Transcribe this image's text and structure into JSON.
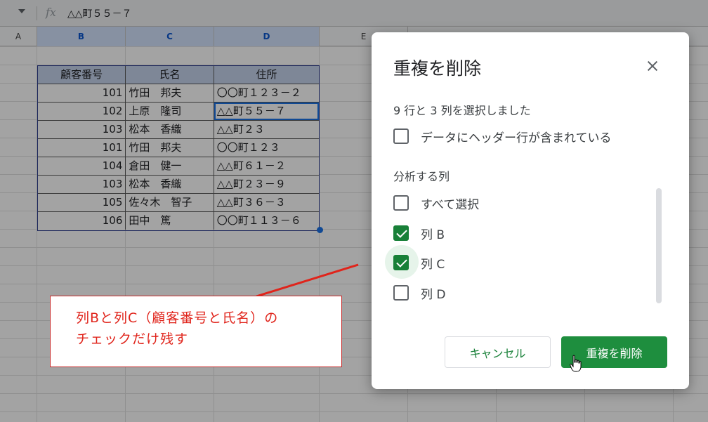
{
  "formula_bar": {
    "fx_label": "fx",
    "content": "△△町５５－７"
  },
  "sheet": {
    "column_headers": [
      "A",
      "B",
      "C",
      "D",
      "E"
    ],
    "table": {
      "headers": [
        "顧客番号",
        "氏名",
        "住所"
      ],
      "rows": [
        [
          "101",
          "竹田　邦夫",
          "〇〇町１２３－２"
        ],
        [
          "102",
          "上原　隆司",
          "△△町５５－７"
        ],
        [
          "103",
          "松本　香織",
          "△△町２３"
        ],
        [
          "101",
          "竹田　邦夫",
          "〇〇町１２３"
        ],
        [
          "104",
          "倉田　健一",
          "△△町６１－２"
        ],
        [
          "103",
          "松本　香織",
          "△△町２３－９"
        ],
        [
          "105",
          "佐々木　智子",
          "△△町３６－３"
        ],
        [
          "106",
          "田中　篤",
          "〇〇町１１３－６"
        ]
      ]
    }
  },
  "annotation": {
    "line1": "列Bと列C（顧客番号と氏名）の",
    "line2": "チェックだけ残す",
    "color": "#e0241b"
  },
  "dialog": {
    "title": "重複を削除",
    "selection_info": "9 行と 3 列を選択しました",
    "header_row_label": "データにヘッダー行が含まれている",
    "header_row_checked": false,
    "columns_section": "分析する列",
    "select_all_label": "すべて選択",
    "select_all_checked": false,
    "columns": [
      {
        "label": "列 B",
        "checked": true
      },
      {
        "label": "列 C",
        "checked": true
      },
      {
        "label": "列 D",
        "checked": false
      }
    ],
    "cancel_label": "キャンセル",
    "confirm_label": "重複を削除",
    "accent_color": "#188038"
  }
}
